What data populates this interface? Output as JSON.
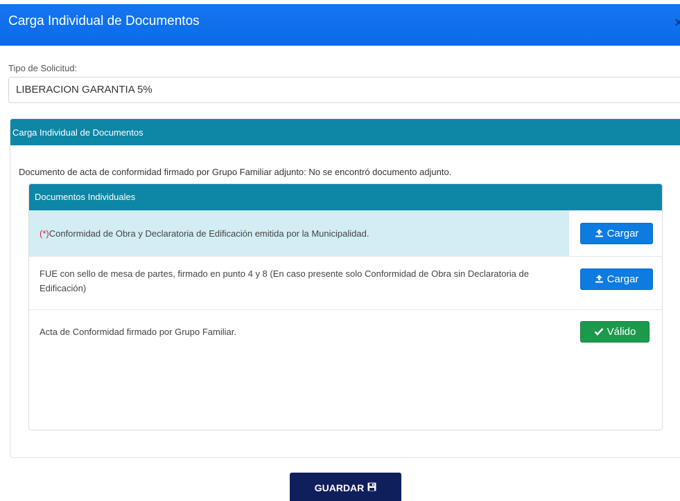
{
  "modal": {
    "title": "Carga Individual de Documentos",
    "close_label": "×"
  },
  "form": {
    "tipo_label": "Tipo de Solicitud:",
    "tipo_value": "LIBERACION GARANTIA 5%"
  },
  "panel": {
    "title": "Carga Individual de Documentos",
    "notice": "Documento de acta de conformidad firmado por Grupo Familiar adjunto: No se encontró documento adjunto."
  },
  "documents": {
    "title": "Documentos Individuales",
    "rows": [
      {
        "required_mark": "(*)",
        "text": "Conformidad de Obra y Declaratoria de Edificación emitida por la Municipalidad.",
        "action_label": "Cargar",
        "action_type": "upload"
      },
      {
        "required_mark": "",
        "text": "FUE con sello de mesa de partes, firmado en punto 4 y 8 (En caso presente solo Conformidad de Obra sin Declaratoria de Edificación)",
        "action_label": "Cargar",
        "action_type": "upload"
      },
      {
        "required_mark": "",
        "text": "Acta de Conformidad firmado por Grupo Familiar.",
        "action_label": "Válido",
        "action_type": "valid"
      }
    ]
  },
  "footer": {
    "save_label": "GUARDAR"
  },
  "icons": {
    "upload": "upload-icon",
    "check": "check-icon",
    "save": "floppy-disk-icon",
    "close": "close-icon"
  },
  "colors": {
    "header": "#0a6ae8",
    "panel_head": "#0e86a6",
    "upload_button": "#0d7be0",
    "valid_button": "#1c9a4c",
    "save_button": "#0f1f5c",
    "highlight_row": "#d2eef4",
    "required": "#d9232d"
  }
}
